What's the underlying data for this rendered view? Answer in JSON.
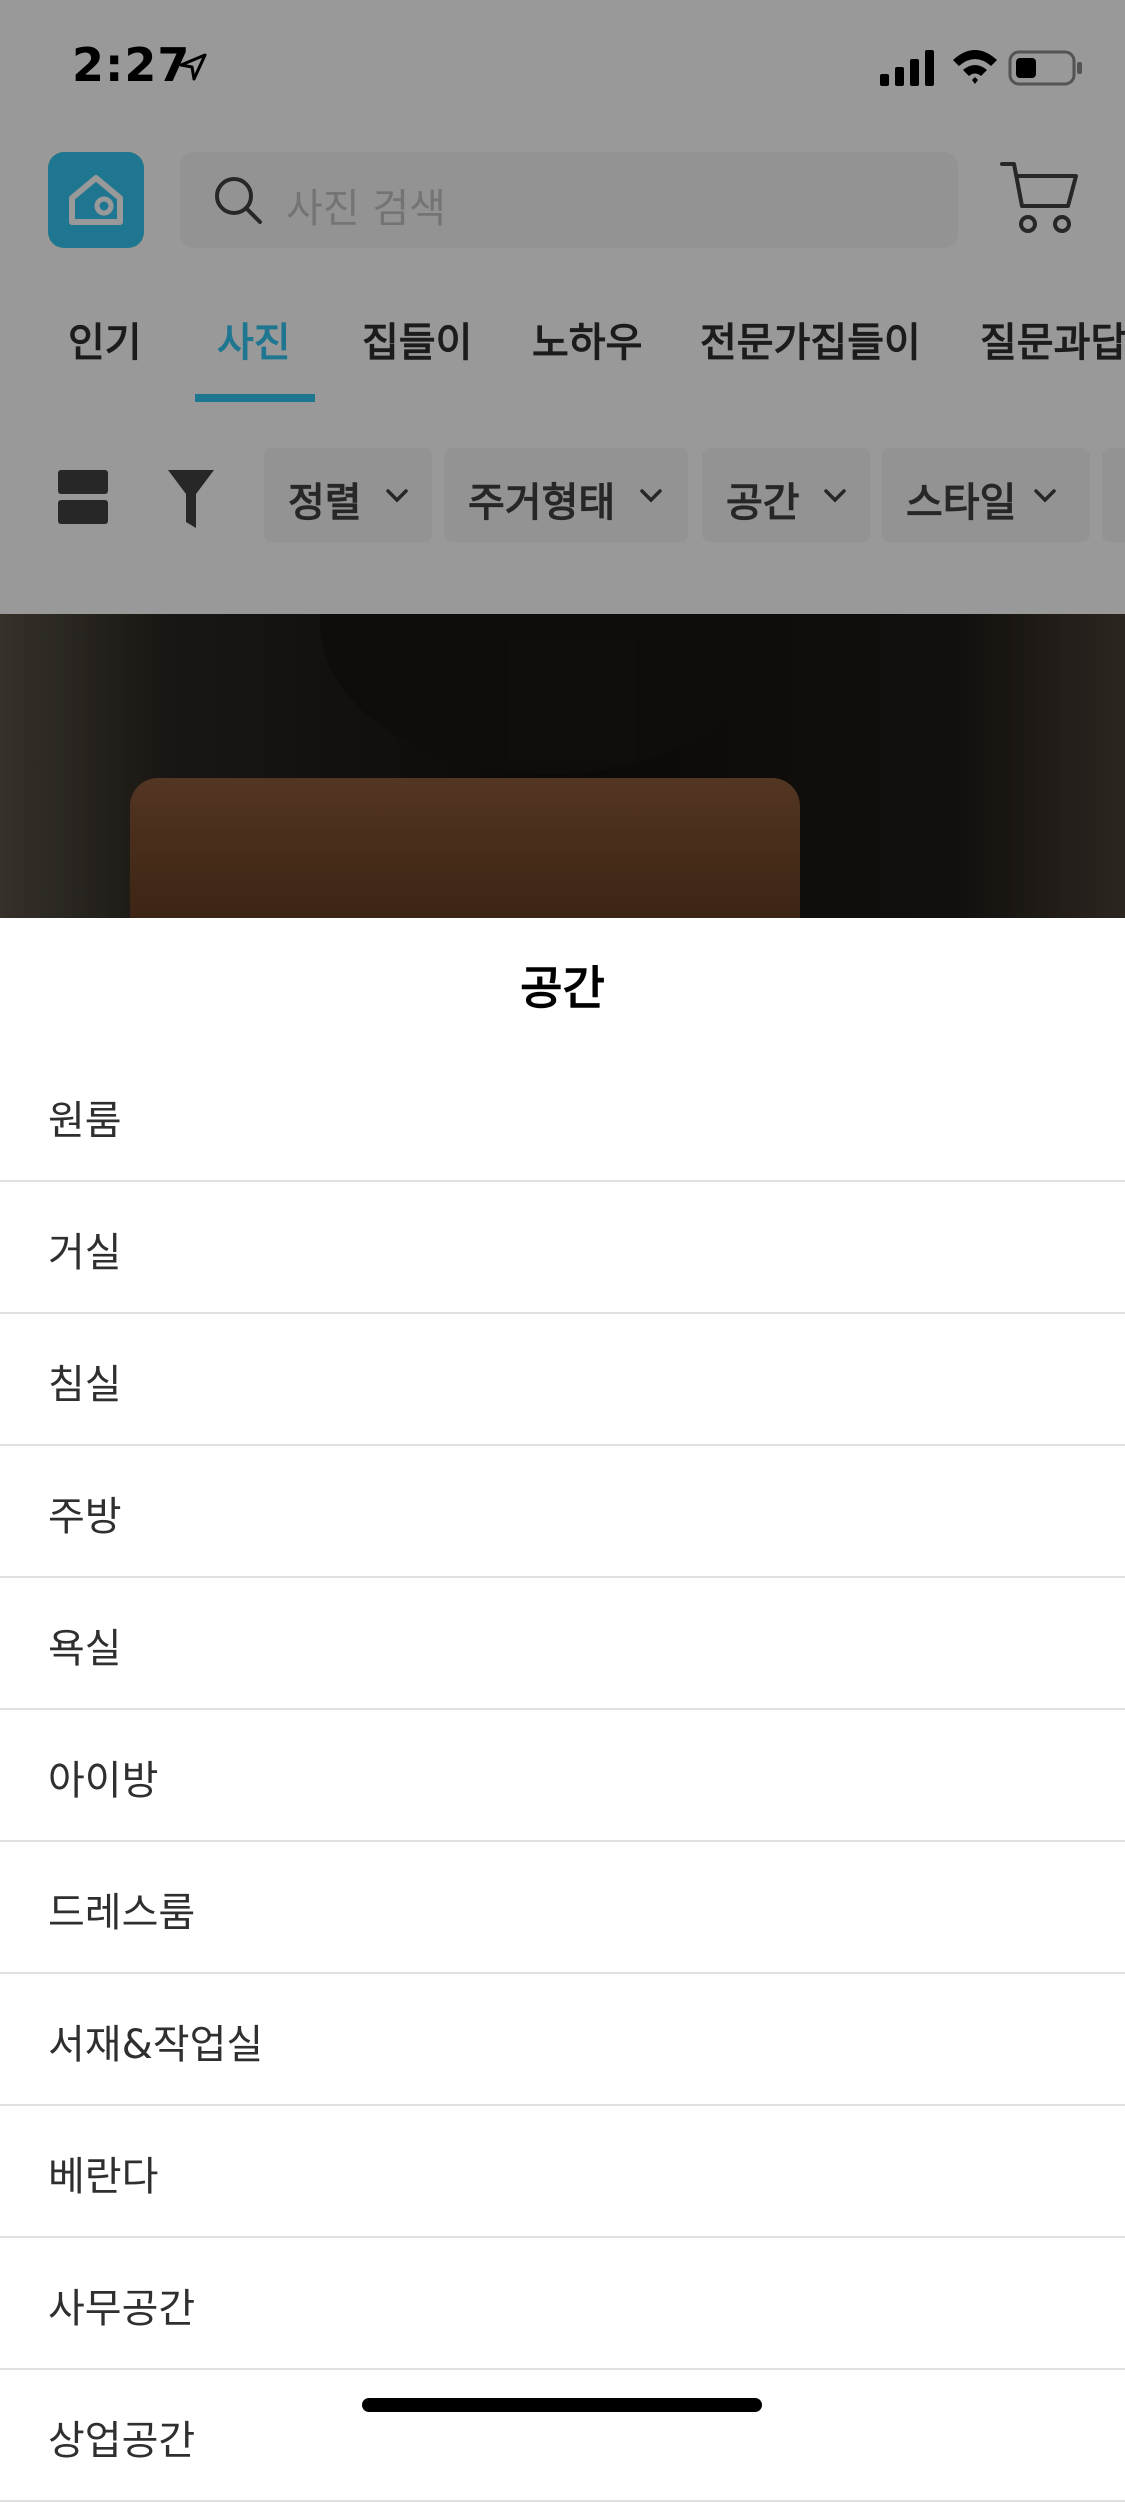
{
  "status_bar": {
    "time": "2:27",
    "icons": [
      "location-arrow-icon",
      "cellular-signal-icon",
      "wifi-icon",
      "battery-icon"
    ]
  },
  "header": {
    "logo_icon": "home-logo-icon",
    "search_placeholder": "사진 검색",
    "cart_icon": "cart-icon"
  },
  "tabs": [
    {
      "label": "인기",
      "active": false
    },
    {
      "label": "사진",
      "active": true
    },
    {
      "label": "집들이",
      "active": false
    },
    {
      "label": "노하우",
      "active": false
    },
    {
      "label": "전문가집들이",
      "active": false
    },
    {
      "label": "질문과답",
      "active": false
    }
  ],
  "filters": {
    "layout_icon": "layout-toggle-icon",
    "filter_icon": "filter-funnel-icon",
    "chips": [
      {
        "label": "정렬"
      },
      {
        "label": "주거형태"
      },
      {
        "label": "공간"
      },
      {
        "label": "스타일"
      }
    ]
  },
  "sheet": {
    "title": "공간",
    "options": [
      "원룸",
      "거실",
      "침실",
      "주방",
      "욕실",
      "아이방",
      "드레스룸",
      "서재&작업실",
      "베란다",
      "사무공간",
      "상업공간"
    ]
  },
  "colors": {
    "accent": "#35c5f0",
    "overlay": "rgba(0,0,0,0.4)"
  }
}
